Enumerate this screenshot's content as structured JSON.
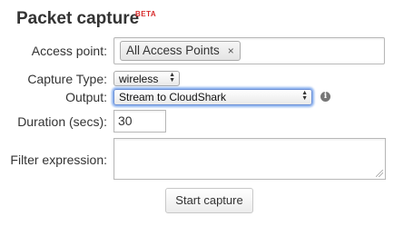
{
  "header": {
    "title": "Packet capture",
    "badge": "BETA"
  },
  "form": {
    "access_point": {
      "label": "Access point:",
      "tokens": [
        "All Access Points"
      ],
      "remove_glyph": "×"
    },
    "capture_type": {
      "label": "Capture Type:",
      "selected": "wireless"
    },
    "output": {
      "label": "Output:",
      "selected": "Stream to CloudShark",
      "info_icon": "info-icon"
    },
    "duration": {
      "label": "Duration (secs):",
      "value": "30"
    },
    "filter": {
      "label": "Filter expression:",
      "value": ""
    },
    "submit_label": "Start capture"
  },
  "colors": {
    "badge": "#d82c2c",
    "focus_ring": "#8db3f0"
  }
}
